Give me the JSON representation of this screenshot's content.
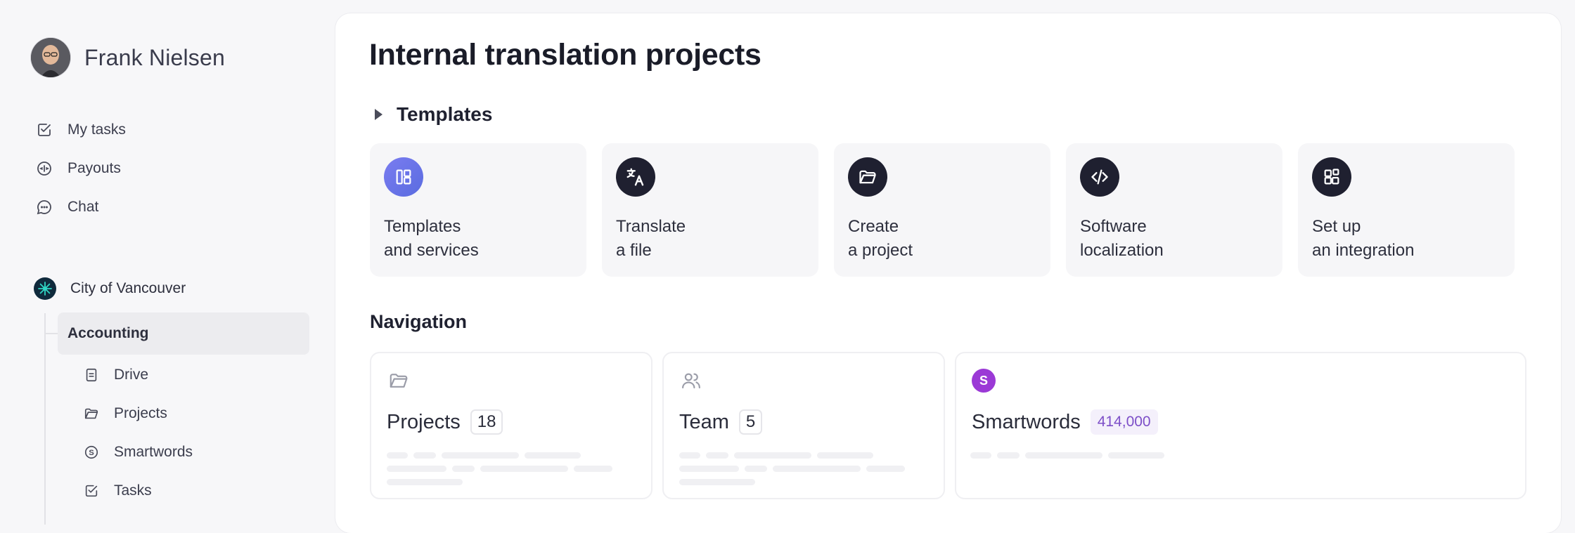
{
  "user": {
    "name": "Frank Nielsen"
  },
  "sidebar": {
    "items": [
      {
        "label": "My tasks",
        "icon": "check-square-icon"
      },
      {
        "label": "Payouts",
        "icon": "payout-icon"
      },
      {
        "label": "Chat",
        "icon": "chat-icon"
      }
    ],
    "org": {
      "name": "City of Vancouver"
    },
    "folder": {
      "name": "Accounting"
    },
    "subitems": [
      {
        "label": "Drive",
        "icon": "file-icon"
      },
      {
        "label": "Projects",
        "icon": "folder-open-icon"
      },
      {
        "label": "Smartwords",
        "icon": "smartwords-icon"
      },
      {
        "label": "Tasks",
        "icon": "check-square-icon"
      }
    ]
  },
  "main": {
    "title": "Internal translation projects",
    "templates_label": "Templates",
    "templates": [
      {
        "line1": "Templates",
        "line2": "and services",
        "icon": "layout-icon"
      },
      {
        "line1": "Translate",
        "line2": "a file",
        "icon": "translate-icon"
      },
      {
        "line1": "Create",
        "line2": "a project",
        "icon": "folder-icon"
      },
      {
        "line1": "Software",
        "line2": "localization",
        "icon": "code-icon"
      },
      {
        "line1": "Set up",
        "line2": "an integration",
        "icon": "integration-icon"
      }
    ],
    "navigation_label": "Navigation",
    "nav_cards": [
      {
        "title": "Projects",
        "count": "18",
        "icon": "folder-open-icon"
      },
      {
        "title": "Team",
        "count": "5",
        "icon": "users-icon"
      },
      {
        "title": "Smartwords",
        "count": "414,000",
        "icon": "smartwords-badge-icon",
        "icon_letter": "S"
      }
    ]
  },
  "colors": {
    "accent_purple": "#7d4fc8",
    "smartwords_badge": "#9b39d6",
    "template_icon_bg": "#1f2030"
  }
}
